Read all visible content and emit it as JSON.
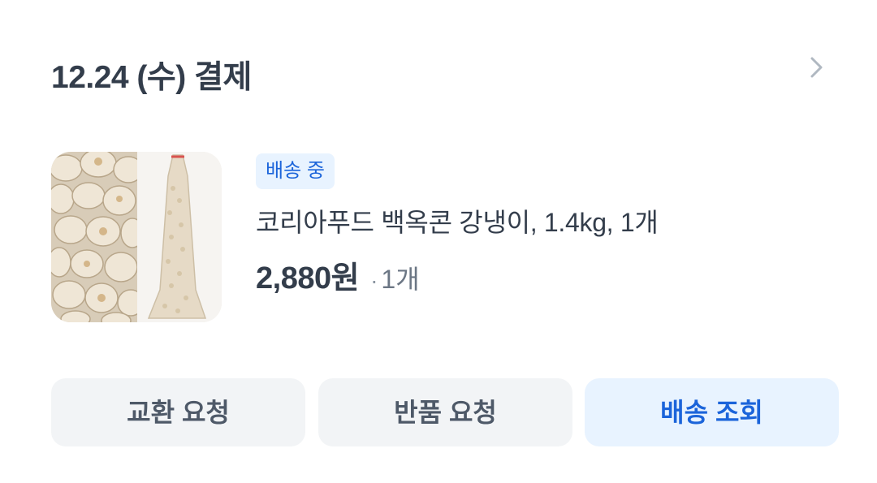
{
  "order": {
    "title": "12.24 (수) 결제",
    "chevron_icon": "chevron-right-icon"
  },
  "product": {
    "status": "배송 중",
    "name": "코리아푸드 백옥콘 강냉이, 1.4kg, 1개",
    "price": "2,880원",
    "quantity_dot": "·",
    "quantity": "1개"
  },
  "actions": {
    "exchange_label": "교환 요청",
    "return_label": "반품 요청",
    "track_label": "배송 조회"
  },
  "colors": {
    "text_primary": "#333d4b",
    "accent_blue": "#1b64da",
    "accent_bg": "#e8f3ff",
    "button_bg": "#f2f4f6"
  }
}
